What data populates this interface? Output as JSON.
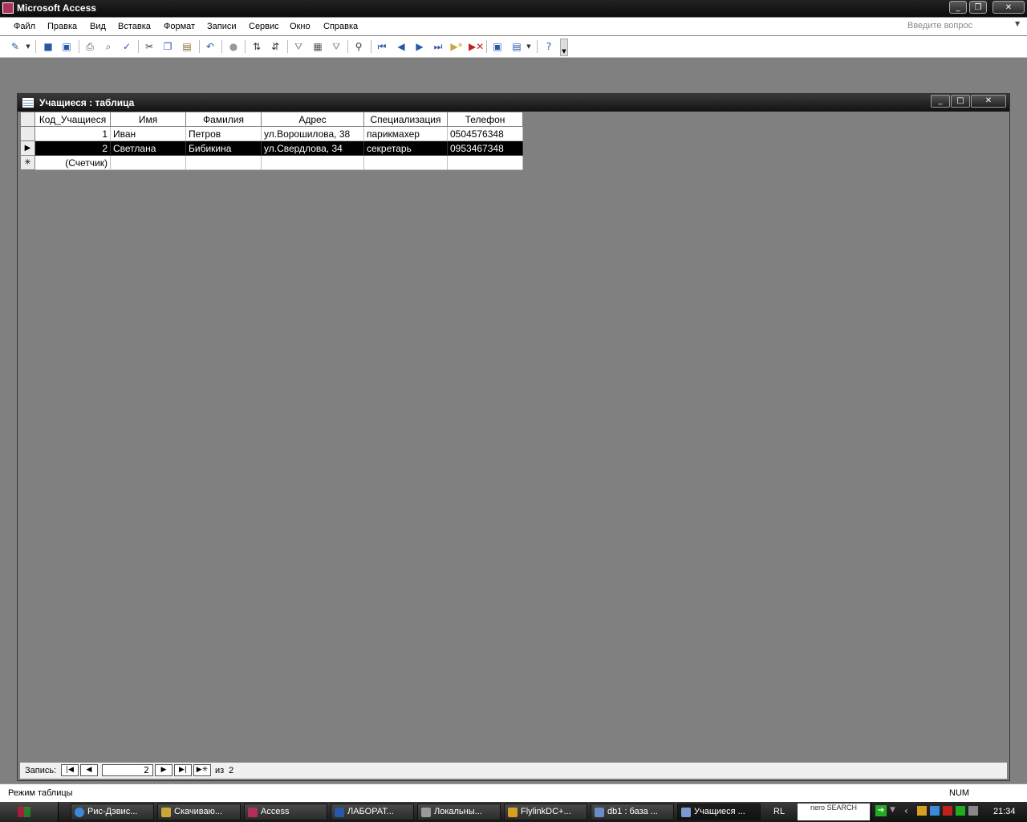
{
  "app": {
    "title": "Microsoft Access"
  },
  "menu": {
    "items": [
      "Файл",
      "Правка",
      "Вид",
      "Вставка",
      "Формат",
      "Записи",
      "Сервис",
      "Окно",
      "Справка"
    ],
    "ask_placeholder": "Введите вопрос"
  },
  "table_window": {
    "title": "Учащиеся : таблица",
    "columns": [
      "Код_Учащиеся",
      "Имя",
      "Фамилия",
      "Адрес",
      "Специализация",
      "Телефон"
    ],
    "rows": [
      [
        "1",
        "Иван",
        "Петров",
        "ул.Ворошилова, 38",
        "парикмахер",
        "0504576348"
      ],
      [
        "2",
        "Светлана",
        "Бибикина",
        "ул.Свердлова, 34",
        "секретарь",
        "0953467348"
      ]
    ],
    "new_row_placeholder": "(Счетчик)",
    "current_row": 2
  },
  "record_nav": {
    "label": "Запись:",
    "current": "2",
    "of_label": "из",
    "total": "2"
  },
  "status_bar": {
    "mode": "Режим таблицы",
    "num": "NUM"
  },
  "taskbar": {
    "tasks": [
      "Рис-Дэвис...",
      "Скачиваю...",
      "Access",
      "ЛАБОРАТ...",
      "Локальны...",
      "FlylinkDC+...",
      "db1 : база ...",
      "Учащиеся ..."
    ],
    "lang": "RL",
    "nero": "nero SEARCH",
    "clock": "21:34"
  },
  "colors": {
    "titlebar": "#0b0b0b",
    "workspace": "#808080",
    "selected_row": "#000000"
  }
}
